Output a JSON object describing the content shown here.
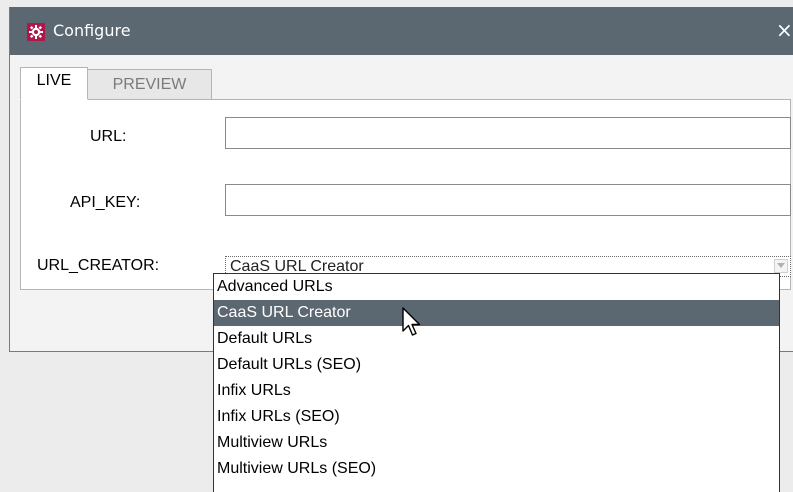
{
  "window": {
    "title": "Configure",
    "close_glyph": "×",
    "icon": "gear-icon",
    "titlebar_color": "#5b6771",
    "icon_color": "#b0174a"
  },
  "tabs": [
    {
      "label": "LIVE",
      "active": true
    },
    {
      "label": "PREVIEW",
      "active": false
    }
  ],
  "form": {
    "url_label": "URL:",
    "url_value": "",
    "api_key_label": "API_KEY:",
    "api_key_value": "",
    "url_creator_label": "URL_CREATOR:",
    "url_creator_value": "CaaS URL Creator"
  },
  "dropdown": {
    "options": [
      "Advanced URLs",
      "CaaS URL Creator",
      "Default URLs",
      "Default URLs (SEO)",
      "Infix URLs",
      "Infix URLs (SEO)",
      "Multiview URLs",
      "Multiview URLs (SEO)"
    ],
    "selected_index": 1,
    "highlight_color": "#5b6771"
  }
}
